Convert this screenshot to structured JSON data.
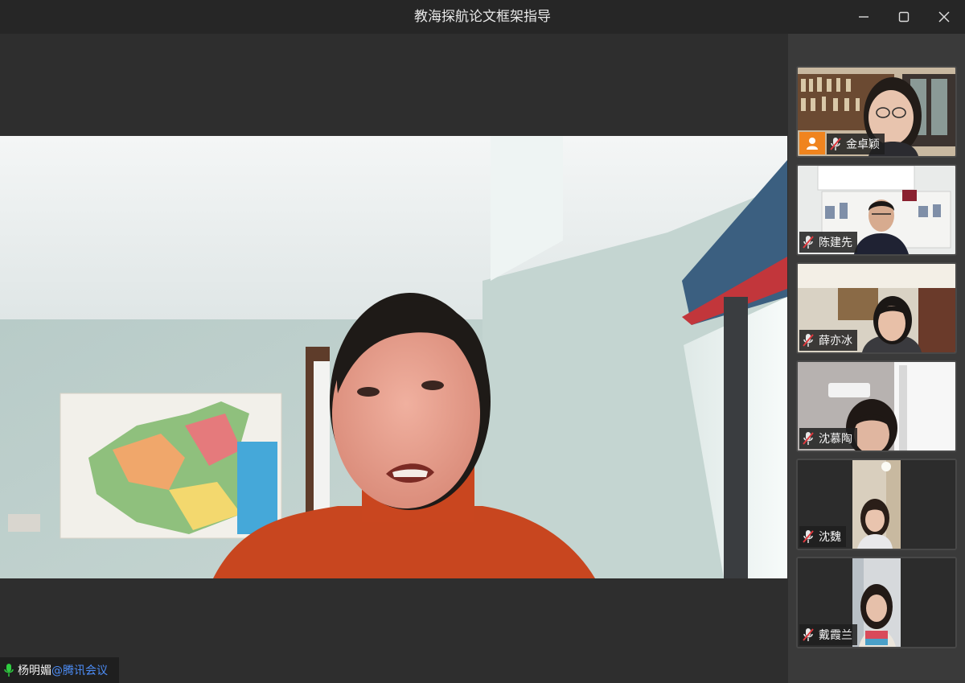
{
  "window": {
    "title": "教海探航论文框架指导"
  },
  "main_video": {
    "speaker_name": "杨明媚",
    "speaker_suffix": "@腾讯会议"
  },
  "participants": [
    {
      "name": "金卓颖",
      "host": true,
      "muted": true
    },
    {
      "name": "陈建先",
      "host": false,
      "muted": true
    },
    {
      "name": "薛亦冰",
      "host": false,
      "muted": true
    },
    {
      "name": "沈慕陶",
      "host": false,
      "muted": true
    },
    {
      "name": "沈魏",
      "host": false,
      "muted": true
    },
    {
      "name": "戴霞兰",
      "host": false,
      "muted": true
    }
  ],
  "colors": {
    "titlebar": "#262626",
    "stage": "#2e2e2e",
    "sidebar": "#3a3a3a",
    "host_badge": "#f0841e",
    "mic_active": "#2ecc40",
    "mic_muted": "#e0393e",
    "brand_link": "#4c8cf5"
  },
  "icons": {
    "minimize": "minimize-icon",
    "maximize": "maximize-icon",
    "close": "close-icon",
    "mic_on": "microphone-icon",
    "mic_off": "microphone-muted-icon",
    "host": "host-user-icon"
  }
}
